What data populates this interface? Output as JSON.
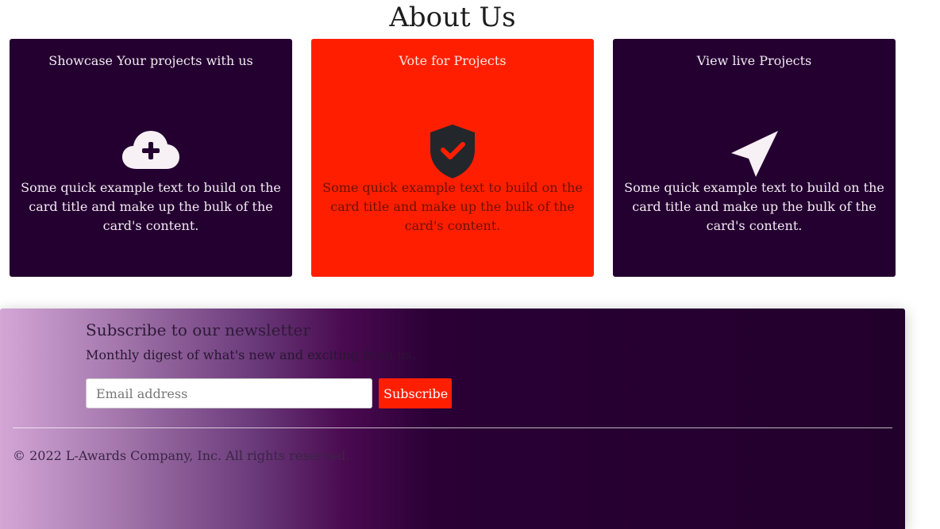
{
  "page": {
    "title": "About Us"
  },
  "cards": [
    {
      "title": "Showcase Your projects with us",
      "icon": "cloud-plus-icon",
      "text": "Some quick example text to build on the card title and make up the bulk of the card's content.",
      "background": "#240030"
    },
    {
      "title": "Vote for Projects",
      "icon": "shield-check-icon",
      "text": "Some quick example text to build on the card title and make up the bulk of the card's content.",
      "background": "#ff1f00"
    },
    {
      "title": "View live Projects",
      "icon": "navigation-arrow-icon",
      "text": "Some quick example text to build on the card title and make up the bulk of the card's content.",
      "background": "#240030"
    }
  ],
  "footer": {
    "newsletter_title": "Subscribe to our newsletter",
    "newsletter_subtitle": "Monthly digest of what's new and exciting from us.",
    "email_value": "",
    "email_placeholder": "Email address",
    "subscribe_label": "Subscribe",
    "copyright": "© 2022 L-Awards Company, Inc. All rights reserved."
  },
  "colors": {
    "accent": "#ff1f00",
    "dark_purple": "#240030",
    "footer_gradient_start": "#d3a6d6"
  }
}
